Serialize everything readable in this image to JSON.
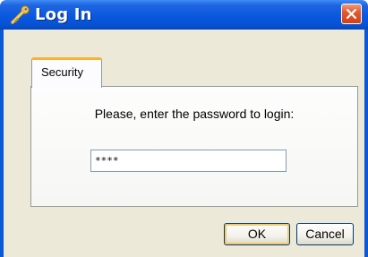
{
  "window": {
    "title": "Log In",
    "title_icon": "key-icon",
    "close_icon": "close-icon"
  },
  "tabs": [
    {
      "label": "Security",
      "selected": true
    }
  ],
  "security": {
    "prompt": "Please, enter the password to login:",
    "password_value": "****"
  },
  "buttons": {
    "ok_label": "OK",
    "cancel_label": "Cancel"
  },
  "colors": {
    "titlebar": "#0a58de",
    "close_button": "#e3592f",
    "tab_highlight": "#f7b237",
    "dialog_background": "#ece9d8"
  }
}
